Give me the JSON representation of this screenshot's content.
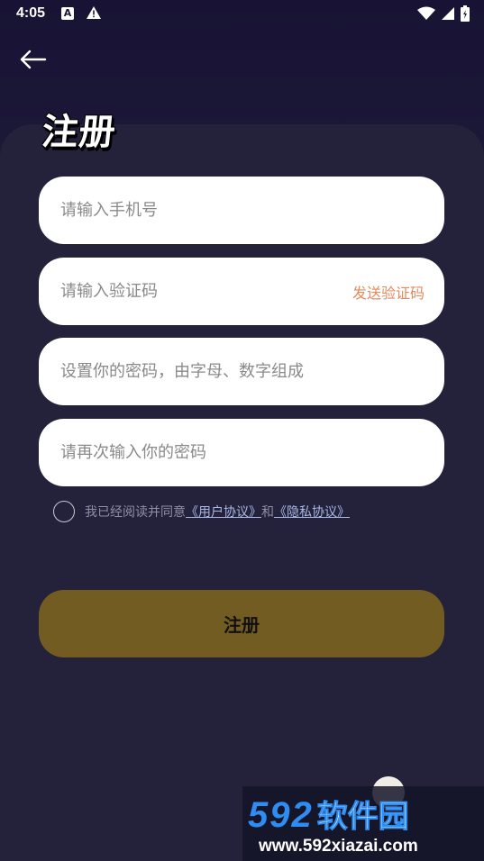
{
  "status_bar": {
    "time": "4:05",
    "icons": [
      "a-notification-icon",
      "warning-icon",
      "wifi-icon",
      "signal-icon",
      "battery-icon"
    ]
  },
  "page": {
    "title": "注册"
  },
  "form": {
    "phone_placeholder": "请输入手机号",
    "code_placeholder": "请输入验证码",
    "send_code_label": "发送验证码",
    "password_placeholder": "设置你的密码，由字母、数字组成",
    "confirm_placeholder": "请再次输入你的密码"
  },
  "agreement": {
    "prefix": "我已经阅读并同意",
    "user_agreement": "《用户协议》",
    "conjunction": "和",
    "privacy_policy": "《隐私协议》"
  },
  "register_button": "注册",
  "watermark": {
    "number": "592",
    "name": "软件园",
    "url": "www.592xiazai.com"
  },
  "colors": {
    "background": "#1b1832",
    "panel": "#23223a",
    "button": "#735c22",
    "accent": "#e38a5e",
    "link": "#a8b8e6"
  }
}
